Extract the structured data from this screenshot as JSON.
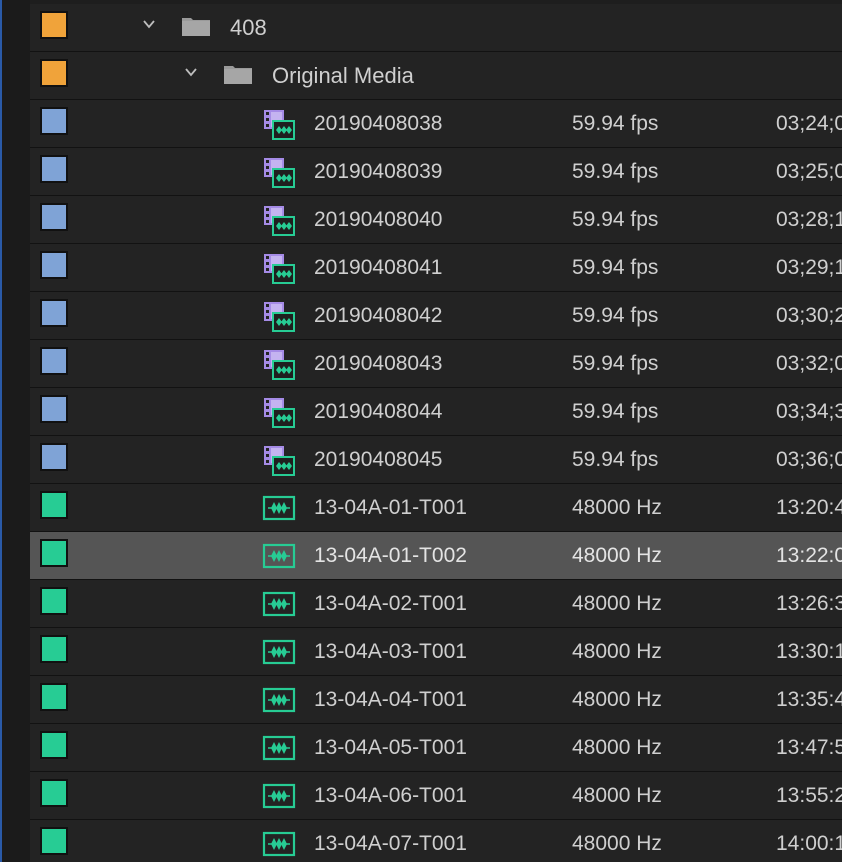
{
  "colors": {
    "bin_label": "#f0a33a",
    "video_label": "#7fa3d6",
    "audio_label": "#27cc94",
    "selected_row": "#555555",
    "video_icon": "#a58be6",
    "audio_icon": "#27cc94"
  },
  "bins": [
    {
      "name": "408",
      "label_color": "#f0a33a",
      "icon": "folder-icon",
      "expanded": true
    },
    {
      "name": "Original Media",
      "label_color": "#f0a33a",
      "icon": "folder-icon",
      "expanded": true
    }
  ],
  "items": [
    {
      "name": "20190408038",
      "rate": "59.94 fps",
      "timecode": "03;24;0",
      "type": "video-audio-clip-icon",
      "label_color": "#7fa3d6"
    },
    {
      "name": "20190408039",
      "rate": "59.94 fps",
      "timecode": "03;25;0",
      "type": "video-audio-clip-icon",
      "label_color": "#7fa3d6"
    },
    {
      "name": "20190408040",
      "rate": "59.94 fps",
      "timecode": "03;28;1",
      "type": "video-audio-clip-icon",
      "label_color": "#7fa3d6"
    },
    {
      "name": "20190408041",
      "rate": "59.94 fps",
      "timecode": "03;29;1",
      "type": "video-audio-clip-icon",
      "label_color": "#7fa3d6"
    },
    {
      "name": "20190408042",
      "rate": "59.94 fps",
      "timecode": "03;30;2",
      "type": "video-audio-clip-icon",
      "label_color": "#7fa3d6"
    },
    {
      "name": "20190408043",
      "rate": "59.94 fps",
      "timecode": "03;32;0",
      "type": "video-audio-clip-icon",
      "label_color": "#7fa3d6"
    },
    {
      "name": "20190408044",
      "rate": "59.94 fps",
      "timecode": "03;34;3",
      "type": "video-audio-clip-icon",
      "label_color": "#7fa3d6"
    },
    {
      "name": "20190408045",
      "rate": "59.94 fps",
      "timecode": "03;36;0",
      "type": "video-audio-clip-icon",
      "label_color": "#7fa3d6"
    },
    {
      "name": "13-04A-01-T001",
      "rate": "48000 Hz",
      "timecode": "13:20:4",
      "type": "audio-clip-icon",
      "label_color": "#27cc94"
    },
    {
      "name": "13-04A-01-T002",
      "rate": "48000 Hz",
      "timecode": "13:22:0",
      "type": "audio-clip-icon",
      "label_color": "#27cc94",
      "selected": true
    },
    {
      "name": "13-04A-02-T001",
      "rate": "48000 Hz",
      "timecode": "13:26:3",
      "type": "audio-clip-icon",
      "label_color": "#27cc94"
    },
    {
      "name": "13-04A-03-T001",
      "rate": "48000 Hz",
      "timecode": "13:30:1",
      "type": "audio-clip-icon",
      "label_color": "#27cc94"
    },
    {
      "name": "13-04A-04-T001",
      "rate": "48000 Hz",
      "timecode": "13:35:4",
      "type": "audio-clip-icon",
      "label_color": "#27cc94"
    },
    {
      "name": "13-04A-05-T001",
      "rate": "48000 Hz",
      "timecode": "13:47:5",
      "type": "audio-clip-icon",
      "label_color": "#27cc94"
    },
    {
      "name": "13-04A-06-T001",
      "rate": "48000 Hz",
      "timecode": "13:55:2",
      "type": "audio-clip-icon",
      "label_color": "#27cc94"
    },
    {
      "name": "13-04A-07-T001",
      "rate": "48000 Hz",
      "timecode": "14:00:1",
      "type": "audio-clip-icon",
      "label_color": "#27cc94"
    }
  ]
}
